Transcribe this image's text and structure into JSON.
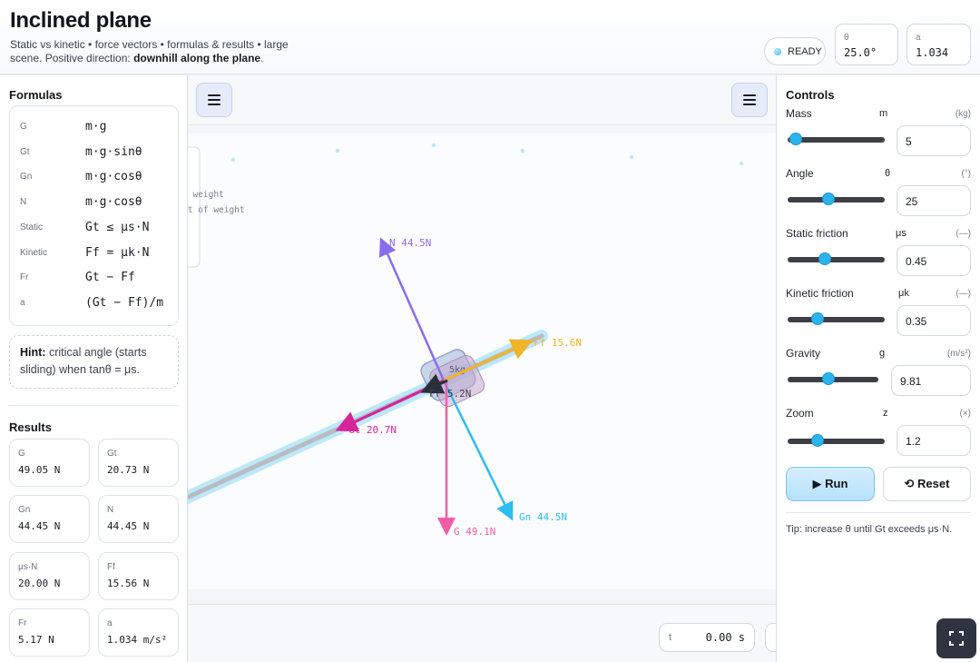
{
  "header": {
    "title": "Inclined plane",
    "subtitle_prefix": "Static vs kinetic • force vectors • formulas & results • large scene. Positive direction: ",
    "subtitle_bold": "downhill along the plane",
    "subtitle_suffix": ".",
    "status": "READY",
    "angle_label": "θ",
    "angle_value": "25.0°",
    "accel_label": "a",
    "accel_value": "1.034"
  },
  "formulas": {
    "title": "Formulas",
    "rows": [
      {
        "key": "G",
        "expr": "m·g"
      },
      {
        "key": "Gt",
        "expr": "m·g·sinθ"
      },
      {
        "key": "Gn",
        "expr": "m·g·cosθ"
      },
      {
        "key": "N",
        "expr": "m·g·cosθ"
      },
      {
        "key": "Static",
        "expr": "Gt ≤ μs·N"
      },
      {
        "key": "Kinetic",
        "expr": "Ff = μk·N"
      },
      {
        "key": "Fr",
        "expr": "Gt − Ff"
      },
      {
        "key": "a",
        "expr": "(Gt − Ff)/m"
      }
    ],
    "hint_bold": "Hint:",
    "hint_text": " critical angle (starts sliding) when tanθ = μs."
  },
  "results": {
    "title": "Results",
    "items": [
      {
        "key": "G",
        "value": "49.05 N"
      },
      {
        "key": "Gt",
        "value": "20.73 N"
      },
      {
        "key": "Gn",
        "value": "44.45 N"
      },
      {
        "key": "N",
        "value": "44.45 N"
      },
      {
        "key": "μs·N",
        "value": "20.00 N"
      },
      {
        "key": "Ff",
        "value": "15.56 N"
      },
      {
        "key": "Fr",
        "value": "5.17 N"
      },
      {
        "key": "a",
        "value": "1.034 m/s²"
      }
    ]
  },
  "scene": {
    "legend_line1": "f weight",
    "legend_line2": "nt of weight",
    "vectors": {
      "N": "N 44.5N",
      "Ff": "Ff 15.6N",
      "Gt": "Gt 20.7N",
      "Gn": "Gn 44.5N",
      "G": "G 49.1N",
      "Fr": "Fr 5.2N"
    },
    "block_label": "5kg",
    "time_label": "t",
    "time_value": "0.00 s",
    "colors": {
      "N": "#8a6cf0",
      "Ff": "#f0b429",
      "Gt": "#d6249a",
      "Gn": "#2bbdf0",
      "G": "#f25ca8",
      "Fr": "#2a2f3a"
    }
  },
  "controls": {
    "title": "Controls",
    "items": [
      {
        "label": "Mass",
        "symbol": "m",
        "unit": "(kg)",
        "value": "5",
        "slider_fraction": 0.08
      },
      {
        "label": "Angle",
        "symbol": "θ",
        "unit": "(°)",
        "value": "25",
        "slider_fraction": 0.42
      },
      {
        "label": "Static friction",
        "symbol": "μs",
        "unit": "(—)",
        "value": "0.45",
        "slider_fraction": 0.38
      },
      {
        "label": "Kinetic friction",
        "symbol": "μk",
        "unit": "(—)",
        "value": "0.35",
        "slider_fraction": 0.31
      },
      {
        "label": "Gravity",
        "symbol": "g",
        "unit": "(m/s²)",
        "value": "9.81",
        "slider_fraction": 0.45
      },
      {
        "label": "Zoom",
        "symbol": "z",
        "unit": "(×)",
        "value": "1.2",
        "slider_fraction": 0.31
      }
    ],
    "run_label": "▶ Run",
    "reset_label": "⟲ Reset",
    "tip": "Tip: increase θ until Gt exceeds μs·N."
  },
  "icons": {
    "menu_left": "hamburger-icon",
    "menu_right": "hamburger-icon",
    "fullscreen": "fullscreen-icon"
  }
}
